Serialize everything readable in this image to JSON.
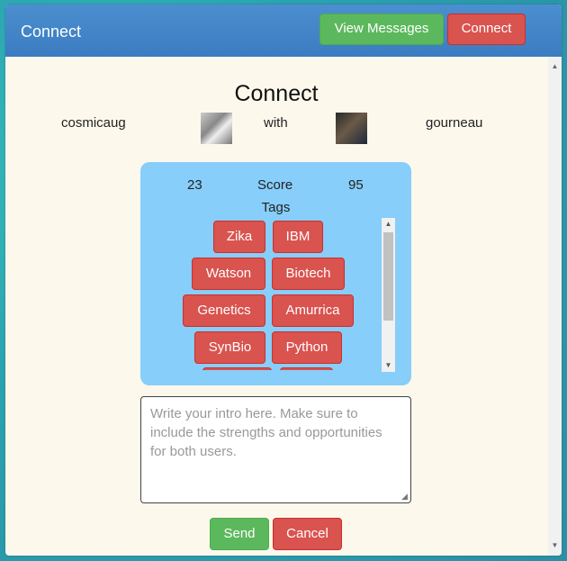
{
  "header": {
    "title": "Connect",
    "view_messages_label": "View Messages",
    "connect_label": "Connect"
  },
  "main": {
    "heading": "Connect",
    "user_left": "cosmicaug",
    "with_label": "with",
    "user_right": "gourneau",
    "score": {
      "left_value": "23",
      "label": "Score",
      "right_value": "95"
    },
    "tags_label": "Tags",
    "tags": [
      "Zika",
      "IBM",
      "Watson",
      "Biotech",
      "Genetics",
      "Amurrica",
      "SynBio",
      "Python"
    ],
    "intro_placeholder": "Write your intro here. Make sure to include the strengths and opportunities for both users.",
    "send_label": "Send",
    "cancel_label": "Cancel"
  },
  "icons": {
    "scroll_up": "chevron-up-icon",
    "scroll_down": "chevron-down-icon"
  },
  "colors": {
    "header_blue": "#3b7cc0",
    "success_green": "#5cb85c",
    "danger_red": "#d9534f",
    "panel_blue": "#87cefa",
    "page_background": "#fdf8ec"
  }
}
